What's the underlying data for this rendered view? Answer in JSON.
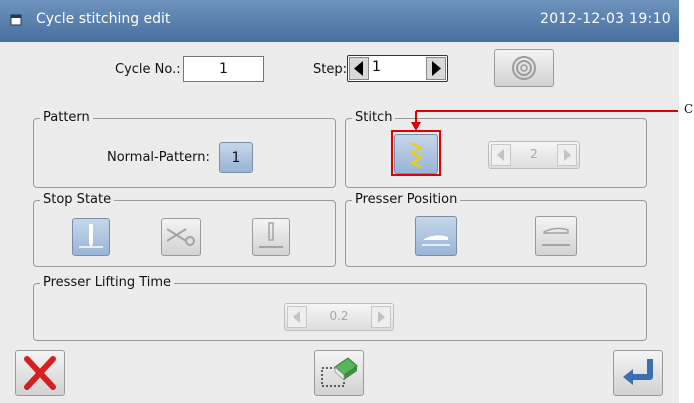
{
  "titlebar": {
    "title": "Cycle stitching edit",
    "datetime": "2012-12-03  19:10",
    "icon": "window-icon"
  },
  "top": {
    "cycle_label": "Cycle No.:",
    "cycle_value": "1",
    "step_label": "Step:",
    "step_value": "1",
    "reset_icon": "concentric-circles-icon"
  },
  "pattern": {
    "legend": "Pattern",
    "label": "Normal-Pattern:",
    "value": "1"
  },
  "stitch": {
    "legend": "Stitch",
    "stitch_icon": "zigzag-stitch-icon",
    "stepper_value": "2"
  },
  "stop_state": {
    "legend": "Stop State",
    "icons": [
      "needle-down-icon",
      "scissors-icon",
      "needle-up-icon"
    ]
  },
  "presser_position": {
    "legend": "Presser Position",
    "icons": [
      "presser-down-icon",
      "presser-up-icon"
    ]
  },
  "presser_lifting": {
    "legend": "Presser Lifting Time",
    "value": "0.2"
  },
  "annotation": {
    "label": "C",
    "color": "#e00000"
  },
  "bottom": {
    "cancel_icon": "red-x-icon",
    "edit_icon": "eraser-icon",
    "enter_icon": "return-arrow-icon"
  },
  "colors": {
    "titlebar": "#5a80ad",
    "accent_blue": "#98b4d6",
    "highlight": "#e00000",
    "stitch_yellow": "#f0d000"
  }
}
